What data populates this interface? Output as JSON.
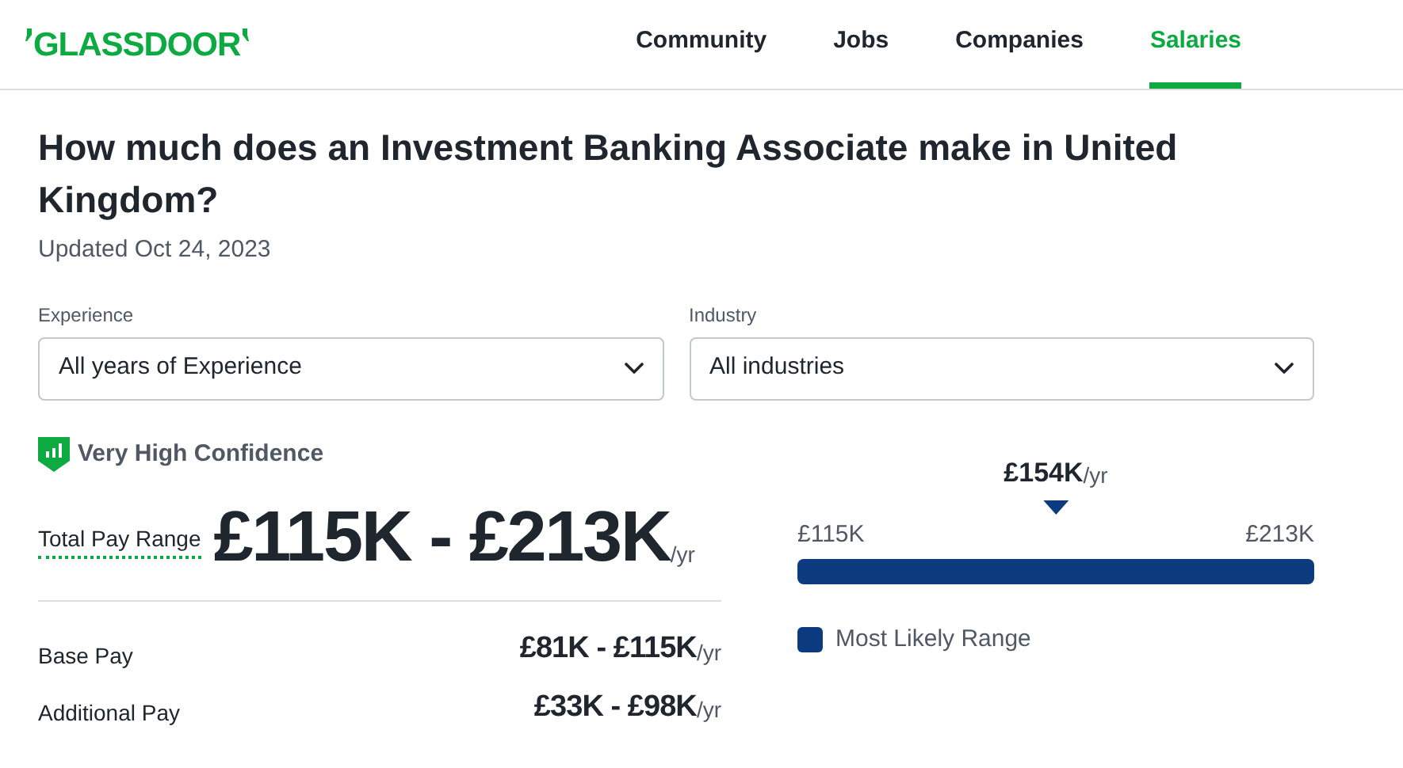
{
  "logo": {
    "text": "GLASSDOOR"
  },
  "nav": [
    {
      "label": "Community",
      "selected": false
    },
    {
      "label": "Jobs",
      "selected": false
    },
    {
      "label": "Companies",
      "selected": false
    },
    {
      "label": "Salaries",
      "selected": true
    }
  ],
  "title": "How much does an Investment Banking Associate make in United Kingdom?",
  "updated": "Updated Oct 24, 2023",
  "filters": [
    {
      "label": "Experience",
      "value": "All years of Experience"
    },
    {
      "label": "Industry",
      "value": "All industries"
    }
  ],
  "confidence": "Very High Confidence",
  "total_pay": {
    "label": "Total Pay Range",
    "value": "£115K - £213K",
    "unit": "/yr"
  },
  "breakdown": [
    {
      "label": "Base Pay",
      "value": "£81K - £115K",
      "unit": "/yr"
    },
    {
      "label": "Additional Pay",
      "value": "£33K - £98K",
      "unit": "/yr"
    }
  ],
  "range_bar": {
    "median": "£154K",
    "median_unit": "/yr",
    "min": "£115K",
    "max": "£213K",
    "legend": "Most Likely Range",
    "color": "#0c3c7f"
  }
}
